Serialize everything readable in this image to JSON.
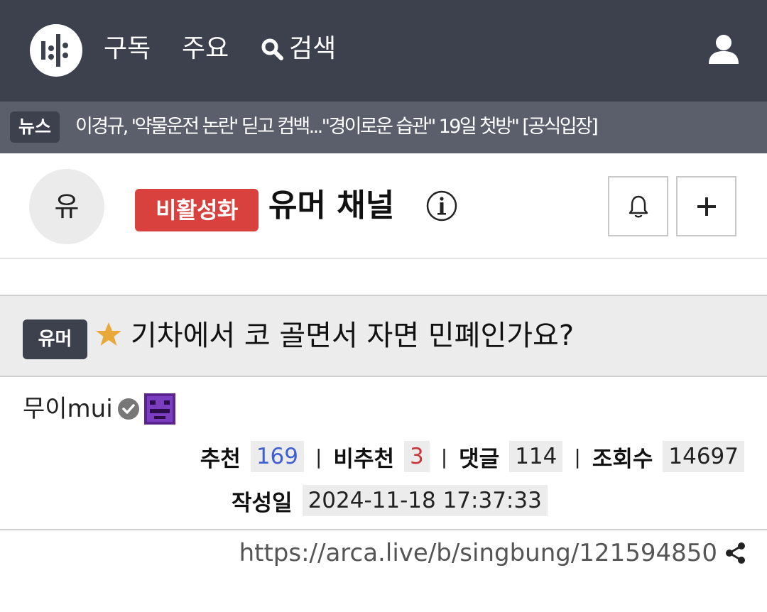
{
  "nav": {
    "subscribe": "구독",
    "featured": "주요",
    "search": "검색"
  },
  "ticker": {
    "badge": "뉴스",
    "headline": "이경규, '약물운전 논란' 딛고 컴백...\"경이로운 습관\" 19일 첫방\" [공식입장]"
  },
  "channel": {
    "avatar_text": "유",
    "status_badge": "비활성화",
    "name": "유머 채널"
  },
  "post": {
    "category": "유머",
    "title": "기차에서 코 골면서 자면 민폐인가요?",
    "author": "무이mui"
  },
  "stats": {
    "upvote_label": "추천",
    "upvote": "169",
    "downvote_label": "비추천",
    "downvote": "3",
    "comments_label": "댓글",
    "comments": "114",
    "views_label": "조회수",
    "views": "14697",
    "date_label": "작성일",
    "date": "2024-11-18 17:37:33"
  },
  "url": "https://arca.live/b/singbung/121594850",
  "colors": {
    "topbar": "#3d414d",
    "ticker": "#5a5f6b",
    "inactive": "#d9413e",
    "upvote": "#3f60d0",
    "downvote": "#c8383a",
    "star": "#e8a93a"
  },
  "icons": [
    "logo-icon",
    "search-icon",
    "user-icon",
    "info-icon",
    "bell-icon",
    "plus-icon",
    "star-icon",
    "verified-icon",
    "share-icon"
  ]
}
